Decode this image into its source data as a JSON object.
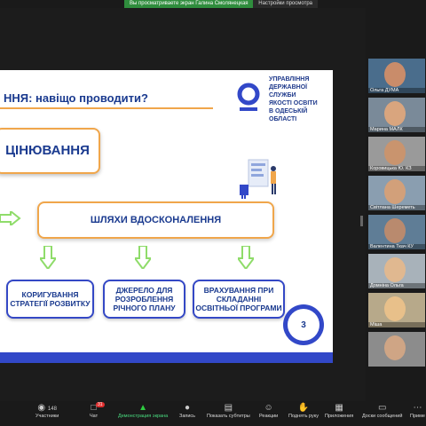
{
  "topbar": {
    "share_notice": "Вы просматриваете экран Галина Смолянецкая",
    "view_options": "Настройки просмотра"
  },
  "slide": {
    "title": "ННЯ: навіщо проводити?",
    "org_lines": [
      "УПРАВЛІННЯ",
      "ДЕРЖАВНОЇ СЛУЖБИ",
      "ЯКОСТІ ОСВІТИ",
      "В ОДЕСЬКІЙ ОБЛАСТІ"
    ],
    "eval_box": "ЦІНЮВАННЯ",
    "paths_box": "ШЛЯХИ ВДОСКОНАЛЕННЯ",
    "boxes": [
      "КОРИГУВАННЯ СТРАТЕГІЇ РОЗВИТКУ",
      "ДЖЕРЕЛО ДЛЯ РОЗРОБЛЕННЯ РІЧНОГО ПЛАНУ",
      "ВРАХУВАННЯ ПРИ СКЛАДАННІ ОСВІТНЬОЇ ПРОГРАМИ"
    ],
    "page_number": "3",
    "colors": {
      "accent_orange": "#f0a64b",
      "brand_blue": "#3248c8",
      "text_blue": "#1a3a8f",
      "arrow_green": "#8fdc6a"
    }
  },
  "participants": [
    {
      "name": "Ольга ДУМА",
      "bg": "#4a6d8c",
      "face": "#c98c6a"
    },
    {
      "name": "Марина МАЛК",
      "bg": "#7a8a99",
      "face": "#d9a57e"
    },
    {
      "name": "Коровицька Ю. КЗ",
      "bg": "#9a9a9a",
      "face": "#c9946e"
    },
    {
      "name": "Світлана Шереметь",
      "bg": "#8a9eb0",
      "face": "#d2a07a"
    },
    {
      "name": "Валентина Ткач КУ",
      "bg": "#5f7d96",
      "face": "#b98a6e"
    },
    {
      "name": "Домніна Ольга",
      "bg": "#a8b2ba",
      "face": "#e0b890"
    },
    {
      "name": "Міша",
      "bg": "#b7a98a",
      "face": "#e8c08a"
    },
    {
      "name": "",
      "bg": "#8c8c8c",
      "face": "#cfa585"
    }
  ],
  "toolbar": {
    "participants_count": "148",
    "participants_label": "Участники",
    "chat_badge": "31",
    "chat_label": "Чат",
    "share_label": "Демонстрация экрана",
    "record_label": "Запись",
    "subtitles_label": "Показать субтитры",
    "reactions_label": "Реакции",
    "raise_hand_label": "Поднять руку",
    "apps_label": "Приложения",
    "whiteboard_label": "Доски сообщений",
    "more_label": "Приме"
  }
}
